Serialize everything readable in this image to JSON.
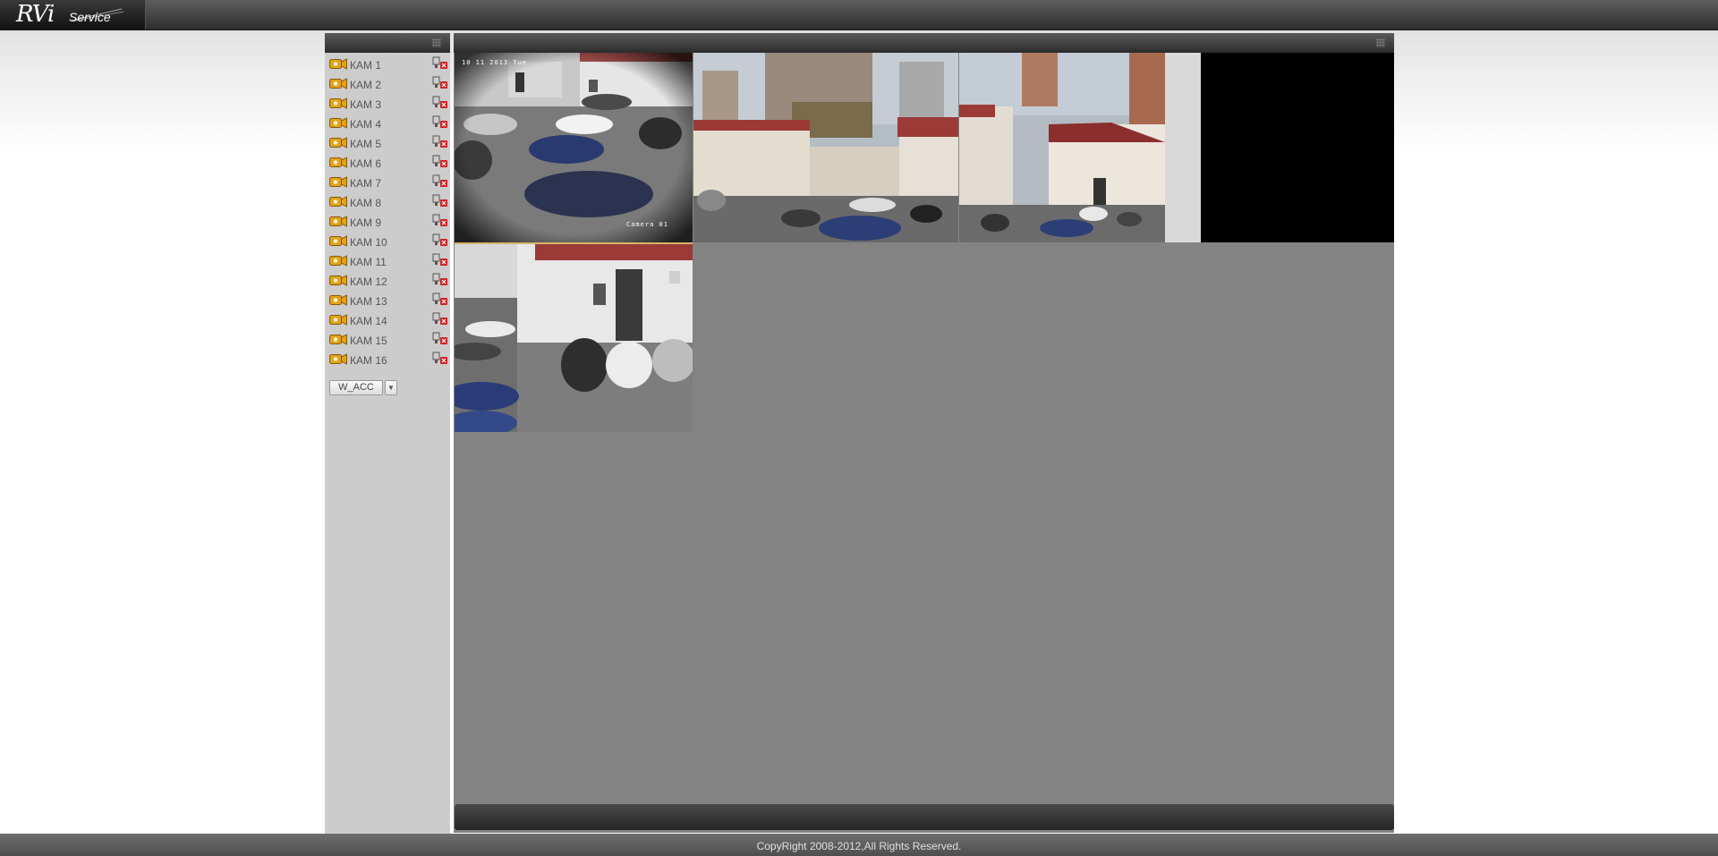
{
  "header": {
    "logo_mark": "RVi",
    "logo_text": "Service"
  },
  "cameras": [
    {
      "label": "КАМ 1"
    },
    {
      "label": "КАМ 2"
    },
    {
      "label": "КАМ 3"
    },
    {
      "label": "КАМ 4"
    },
    {
      "label": "КАМ 5"
    },
    {
      "label": "КАМ 6"
    },
    {
      "label": "КАМ 7"
    },
    {
      "label": "КАМ 8"
    },
    {
      "label": "КАМ 9"
    },
    {
      "label": "КАМ 10"
    },
    {
      "label": "КАМ 11"
    },
    {
      "label": "КАМ 12"
    },
    {
      "label": "КАМ 13"
    },
    {
      "label": "КАМ 14"
    },
    {
      "label": "КАМ 15"
    },
    {
      "label": "КАМ 16"
    }
  ],
  "stream_select": {
    "value": "W_ACC",
    "arrow": "▼"
  },
  "video_tiles": [
    {
      "name": "video-tile-1",
      "osd_top": "10 11 2013 Tue",
      "osd_bottom": "Camera 01",
      "selected": true
    },
    {
      "name": "video-tile-2",
      "osd_top": "",
      "osd_bottom": "",
      "selected": false
    },
    {
      "name": "video-tile-3",
      "osd_top": "",
      "osd_bottom": "",
      "selected": false
    },
    {
      "name": "video-tile-4",
      "osd_top": "",
      "osd_bottom": "",
      "selected": false
    }
  ],
  "footer": {
    "copyright": "CopyRight 2008-2012,All Rights Reserved."
  },
  "colors": {
    "camera_icon": "#e2a21a",
    "record_icon_badge": "#cc2222",
    "selected_tile_border": "#d8b46a",
    "video_area_bg": "#838383"
  }
}
